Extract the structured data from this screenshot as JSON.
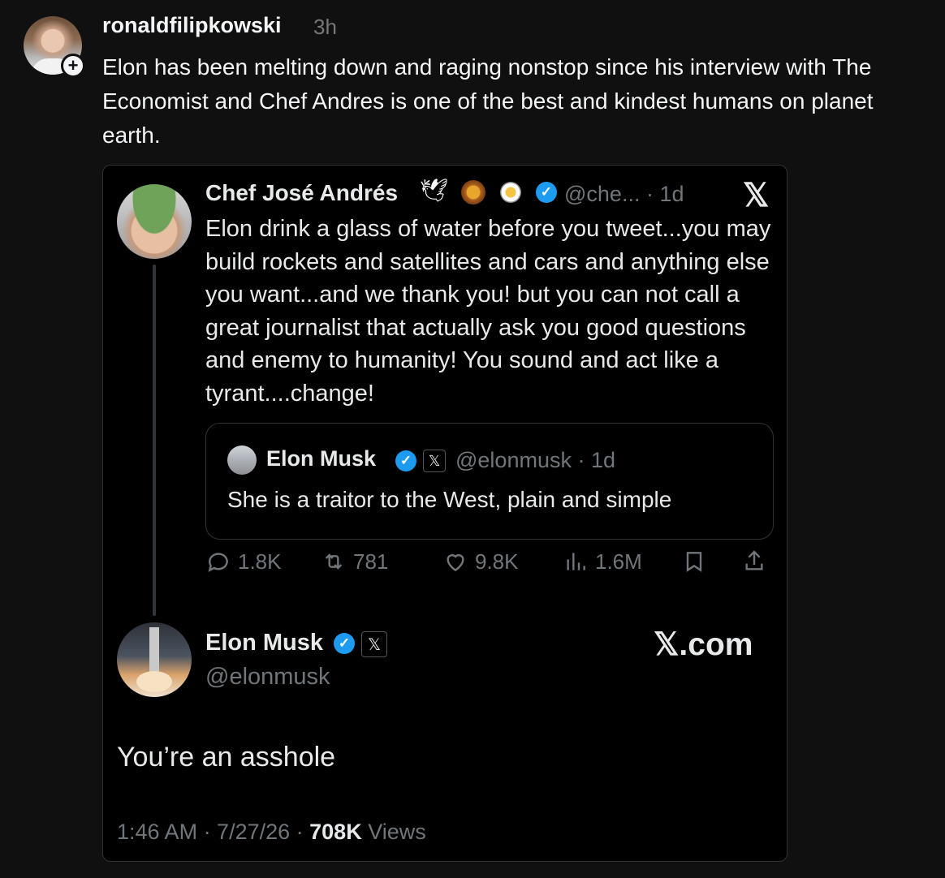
{
  "post": {
    "username": "ronaldfilipkowski",
    "time": "3h",
    "text": "Elon has been melting down and raging nonstop since his interview with The Economist and Chef Andres is one of the best and kindest humans on planet earth."
  },
  "chef_tweet": {
    "name": "Chef José Andrés",
    "emojis": "🕊",
    "handle": "@che... · 1d",
    "platform_logo": "𝕏",
    "text": "Elon drink a glass of water before you tweet...you may build rockets and satellites and cars and anything else you want...and we thank you! but you can not call a great journalist that actually ask you good questions and enemy to humanity! You sound and act like a tyrant....change!"
  },
  "quoted_tweet": {
    "name": "Elon Musk",
    "handle": "@elonmusk · 1d",
    "text": "She is a traitor to the West, plain and simple"
  },
  "actions": {
    "replies": "1.8K",
    "reposts": "781",
    "likes": "9.8K",
    "views": "1.6M"
  },
  "reply_tweet": {
    "name": "Elon Musk",
    "handle": "@elonmusk",
    "site": "𝕏.com",
    "text": "You’re an asshole",
    "time_date": "1:46 AM · 7/27/26 · ",
    "views_count": "708K",
    "views_label": " Views"
  },
  "icons": {
    "verified": "✓",
    "x_badge": "𝕏",
    "plus": "+"
  },
  "colors": {
    "background": "#101010",
    "card": "#000000",
    "verified_blue": "#1d9bf0",
    "muted": "#71767b"
  }
}
